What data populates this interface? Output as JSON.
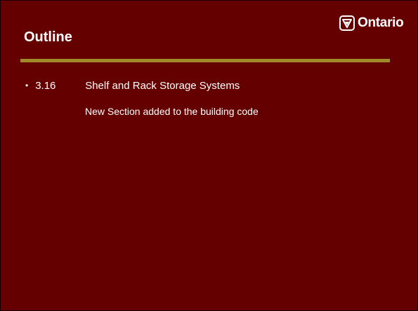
{
  "slide": {
    "title": "Outline",
    "logo": {
      "text": "Ontario",
      "icon": "trillium-icon"
    },
    "bullets": [
      {
        "marker": "•",
        "number": "3.16",
        "text": "Shelf and Rack Storage Systems",
        "subtext": "New Section added to the building code"
      }
    ]
  },
  "colors": {
    "background": "#650000",
    "rule": "#a08a2a",
    "text": "#ffffff"
  }
}
